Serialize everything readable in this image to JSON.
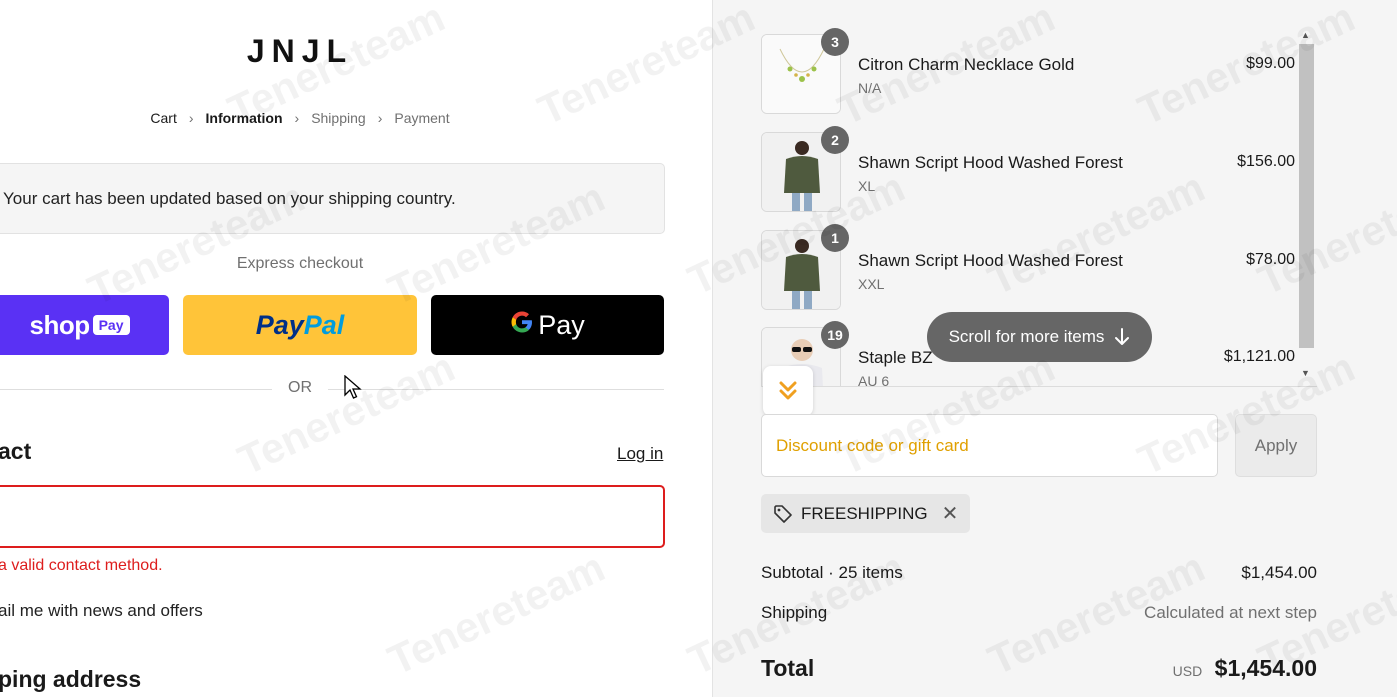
{
  "store": {
    "logo": "JNJL"
  },
  "breadcrumb": {
    "items": [
      "Cart",
      "Information",
      "Shipping",
      "Payment"
    ],
    "separator": ">"
  },
  "notice": {
    "text": "Your cart has been updated based on your shipping country."
  },
  "express": {
    "title": "Express checkout",
    "shop_word": "shop",
    "shop_pay": "Pay",
    "paypal_a": "Pay",
    "paypal_b": "Pal",
    "gpay_g": "G",
    "gpay_word": "Pay",
    "or": "OR"
  },
  "contact": {
    "heading": "act",
    "login": "Log in",
    "error": "a valid contact method.",
    "newsletter": "ail me with news and offers"
  },
  "shipping_heading": "ping address",
  "cart": {
    "items": [
      {
        "qty": "3",
        "name": "Citron Charm Necklace Gold",
        "variant": "N/A",
        "price": "$99.00"
      },
      {
        "qty": "2",
        "name": "Shawn Script Hood Washed Forest",
        "variant": "XL",
        "price": "$156.00"
      },
      {
        "qty": "1",
        "name": "Shawn Script Hood Washed Forest",
        "variant": "XXL",
        "price": "$78.00"
      },
      {
        "qty": "19",
        "name": "Staple BZ",
        "variant": "AU 6",
        "price": "$1,121.00"
      }
    ],
    "scroll_hint": "Scroll for more items"
  },
  "discount": {
    "placeholder": "Discount code or gift card",
    "apply": "Apply",
    "applied_code": "FREESHIPPING"
  },
  "summary": {
    "subtotal_label": "Subtotal · 25 items",
    "subtotal_value": "$1,454.00",
    "shipping_label": "Shipping",
    "shipping_value": "Calculated at next step",
    "total_label": "Total",
    "currency": "USD",
    "total_value": "$1,454.00"
  },
  "watermark": "Tenereteam",
  "colors": {
    "shop_pay": "#5a31f4",
    "paypal": "#ffc439",
    "gpay": "#000000",
    "error": "#dd1d1d",
    "discount_placeholder": "#e0a000"
  },
  "icons": [
    "chevron-right-icon",
    "cursor-icon",
    "tag-icon",
    "close-icon",
    "arrow-down-icon",
    "scroll-up-icon",
    "scroll-down-icon",
    "double-chevron-down-icon"
  ]
}
